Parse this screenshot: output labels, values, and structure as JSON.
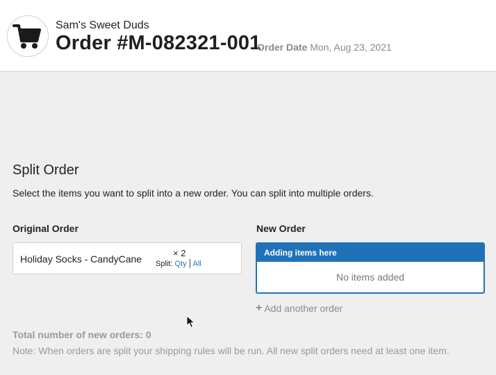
{
  "header": {
    "store_name": "Sam's Sweet Duds",
    "order_title": "Order #M-082321-001",
    "order_date_label": "Order Date",
    "order_date_value": "Mon, Aug 23, 2021",
    "logo_icon": "shopping-cart-icon"
  },
  "split": {
    "title": "Split Order",
    "description": "Select the items you want to split into a new order. You can split into multiple orders.",
    "original_title": "Original Order",
    "new_title": "New Order",
    "items": [
      {
        "name": "Holiday Socks - CandyCane",
        "qty": "× 2",
        "split_label": "Split:",
        "qty_link": "Qty",
        "all_link": "All"
      }
    ],
    "new_order": {
      "header": "Adding items here",
      "empty_text": "No items added"
    },
    "add_another_icon": "plus-icon",
    "add_another": "Add another order",
    "total": "Total number of new orders: 0",
    "note": "Note: When orders are split your shipping rules will be run. All new split orders need at least one item."
  },
  "colors": {
    "accent": "#1f72b8",
    "link": "#1f78c1",
    "muted": "#999999"
  }
}
